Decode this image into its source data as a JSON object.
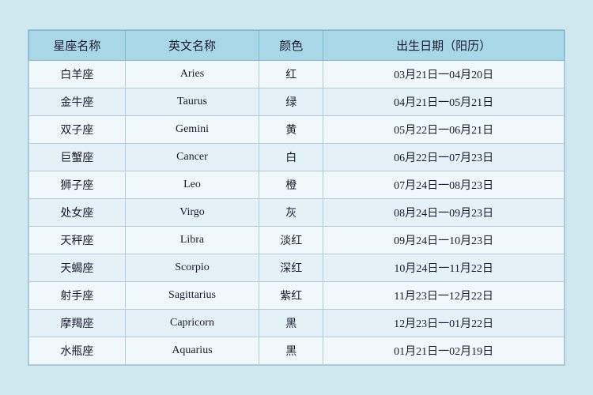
{
  "table": {
    "headers": {
      "cn_name": "星座名称",
      "en_name": "英文名称",
      "color": "颜色",
      "date": "出生日期（阳历）"
    },
    "rows": [
      {
        "cn": "白羊座",
        "en": "Aries",
        "color": "红",
        "date": "03月21日一04月20日"
      },
      {
        "cn": "金牛座",
        "en": "Taurus",
        "color": "绿",
        "date": "04月21日一05月21日"
      },
      {
        "cn": "双子座",
        "en": "Gemini",
        "color": "黄",
        "date": "05月22日一06月21日"
      },
      {
        "cn": "巨蟹座",
        "en": "Cancer",
        "color": "白",
        "date": "06月22日一07月23日"
      },
      {
        "cn": "狮子座",
        "en": "Leo",
        "color": "橙",
        "date": "07月24日一08月23日"
      },
      {
        "cn": "处女座",
        "en": "Virgo",
        "color": "灰",
        "date": "08月24日一09月23日"
      },
      {
        "cn": "天秤座",
        "en": "Libra",
        "color": "淡红",
        "date": "09月24日一10月23日"
      },
      {
        "cn": "天蝎座",
        "en": "Scorpio",
        "color": "深红",
        "date": "10月24日一11月22日"
      },
      {
        "cn": "射手座",
        "en": "Sagittarius",
        "color": "紫红",
        "date": "11月23日一12月22日"
      },
      {
        "cn": "摩羯座",
        "en": "Capricorn",
        "color": "黑",
        "date": "12月23日一01月22日"
      },
      {
        "cn": "水瓶座",
        "en": "Aquarius",
        "color": "黑",
        "date": "01月21日一02月19日"
      }
    ]
  }
}
